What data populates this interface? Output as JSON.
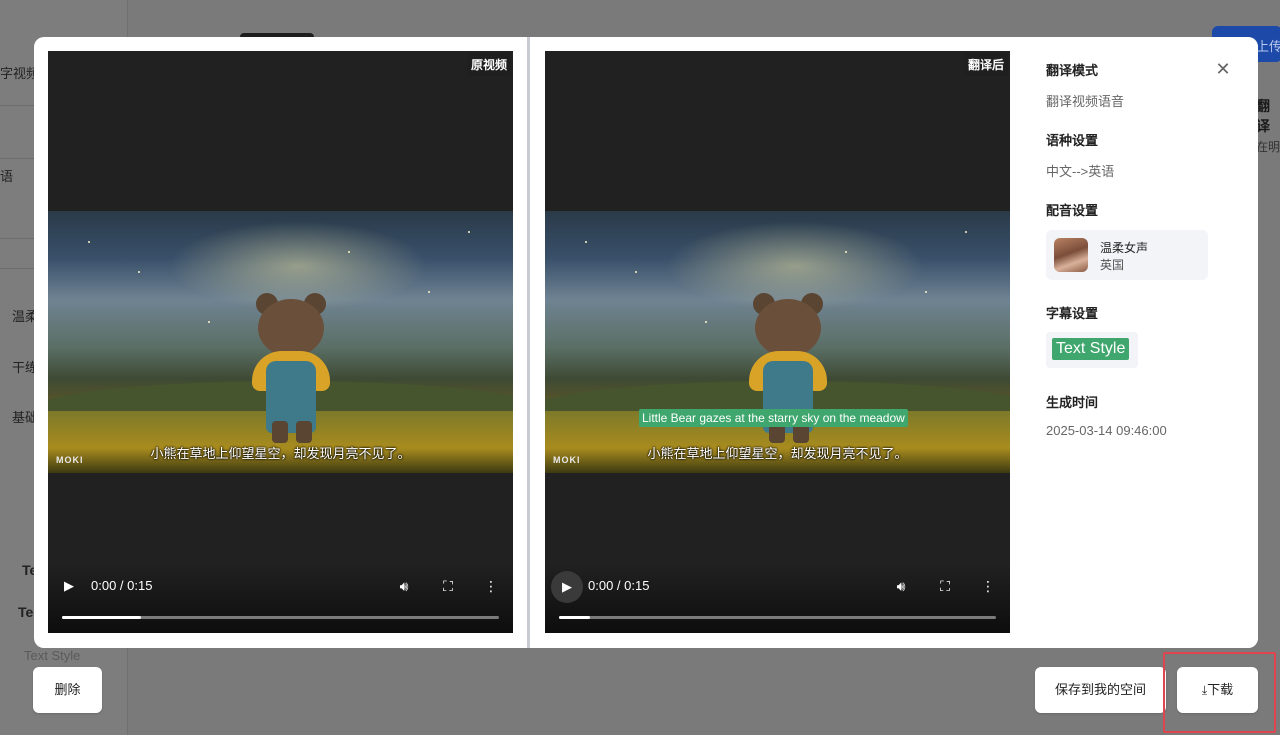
{
  "background": {
    "left_rows": [
      "字视频文",
      "语",
      "温柔",
      "干练",
      "基础",
      "Te",
      "Te",
      "Text Style"
    ],
    "right_button": "上传",
    "right_heading": "翻译",
    "right_sub": "在明"
  },
  "video_left": {
    "tag": "原视频",
    "watermark": "MOKI",
    "subtitle_cn": "小熊在草地上仰望星空，却发现月亮不见了。",
    "time": "0:00 / 0:15",
    "progress": 0.18
  },
  "video_right": {
    "tag": "翻译后",
    "watermark": "MOKI",
    "subtitle_en": "Little Bear gazes at the starry sky on the meadow",
    "subtitle_cn": "小熊在草地上仰望星空，却发现月亮不见了。",
    "time": "0:00 / 0:15",
    "progress": 0.07
  },
  "info": {
    "mode_title": "翻译模式",
    "mode_value": "翻译视频语音",
    "language_title": "语种设置",
    "language_value": "中文-->英语",
    "dubbing_title": "配音设置",
    "voice_name": "温柔女声",
    "voice_region": "英国",
    "subtitle_title": "字幕设置",
    "subtitle_style": "Text Style",
    "time_title": "生成时间",
    "time_value": "2025-03-14 09:46:00"
  },
  "buttons": {
    "delete": "删除",
    "save": "保存到我的空间",
    "download": "下载"
  },
  "icons": {
    "close": "close-icon",
    "play": "play-icon",
    "volume": "volume-icon",
    "fullscreen": "fullscreen-icon",
    "more": "more-vertical-icon",
    "download": "download-icon"
  },
  "colors": {
    "subtitle_green": "#3fa76d",
    "highlight_red": "#e0454f",
    "player_bg": "#212121"
  }
}
